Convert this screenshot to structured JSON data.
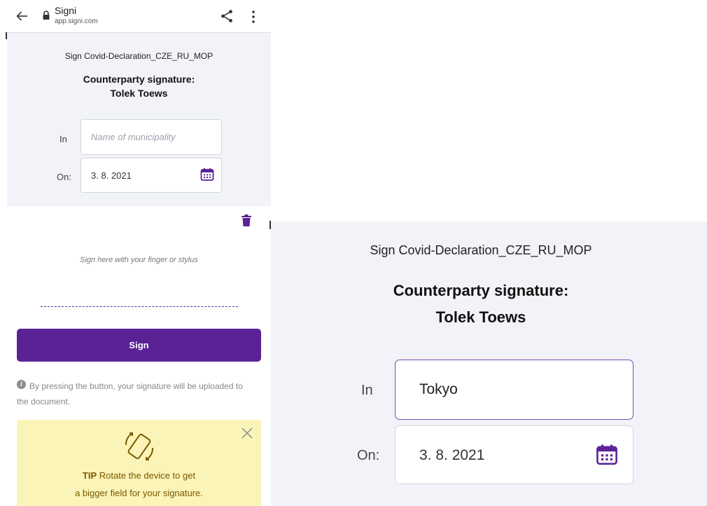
{
  "browser": {
    "site_name": "Signi",
    "site_url": "app.signi.com"
  },
  "form": {
    "document_name": "Sign Covid-Declaration_CZE_RU_MOP",
    "heading": "Counterparty signature:",
    "signer_name": "Tolek Toews",
    "in_label": "In",
    "in_placeholder": "Name of municipality",
    "on_label": "On:",
    "date_value": "3. 8. 2021"
  },
  "signature": {
    "hint": "Sign here with your finger or stylus",
    "sign_button": "Sign",
    "info_text": "By pressing the button, your signature will be uploaded to the document."
  },
  "tip": {
    "label": "TIP",
    "line1": "Rotate the device to get",
    "line2": "a bigger field for your signature."
  },
  "landscape": {
    "in_value": "Tokyo"
  },
  "colors": {
    "accent": "#5b2296",
    "panel_bg": "#f1f3f8",
    "tip_bg": "#fbf4b8"
  },
  "icons": {
    "back": "arrow-left-icon",
    "lock": "lock-icon",
    "share": "share-icon",
    "menu": "more-vertical-icon",
    "calendar": "calendar-icon",
    "trash": "trash-icon",
    "info": "info-icon",
    "close": "close-icon",
    "rotate": "rotate-device-icon"
  }
}
